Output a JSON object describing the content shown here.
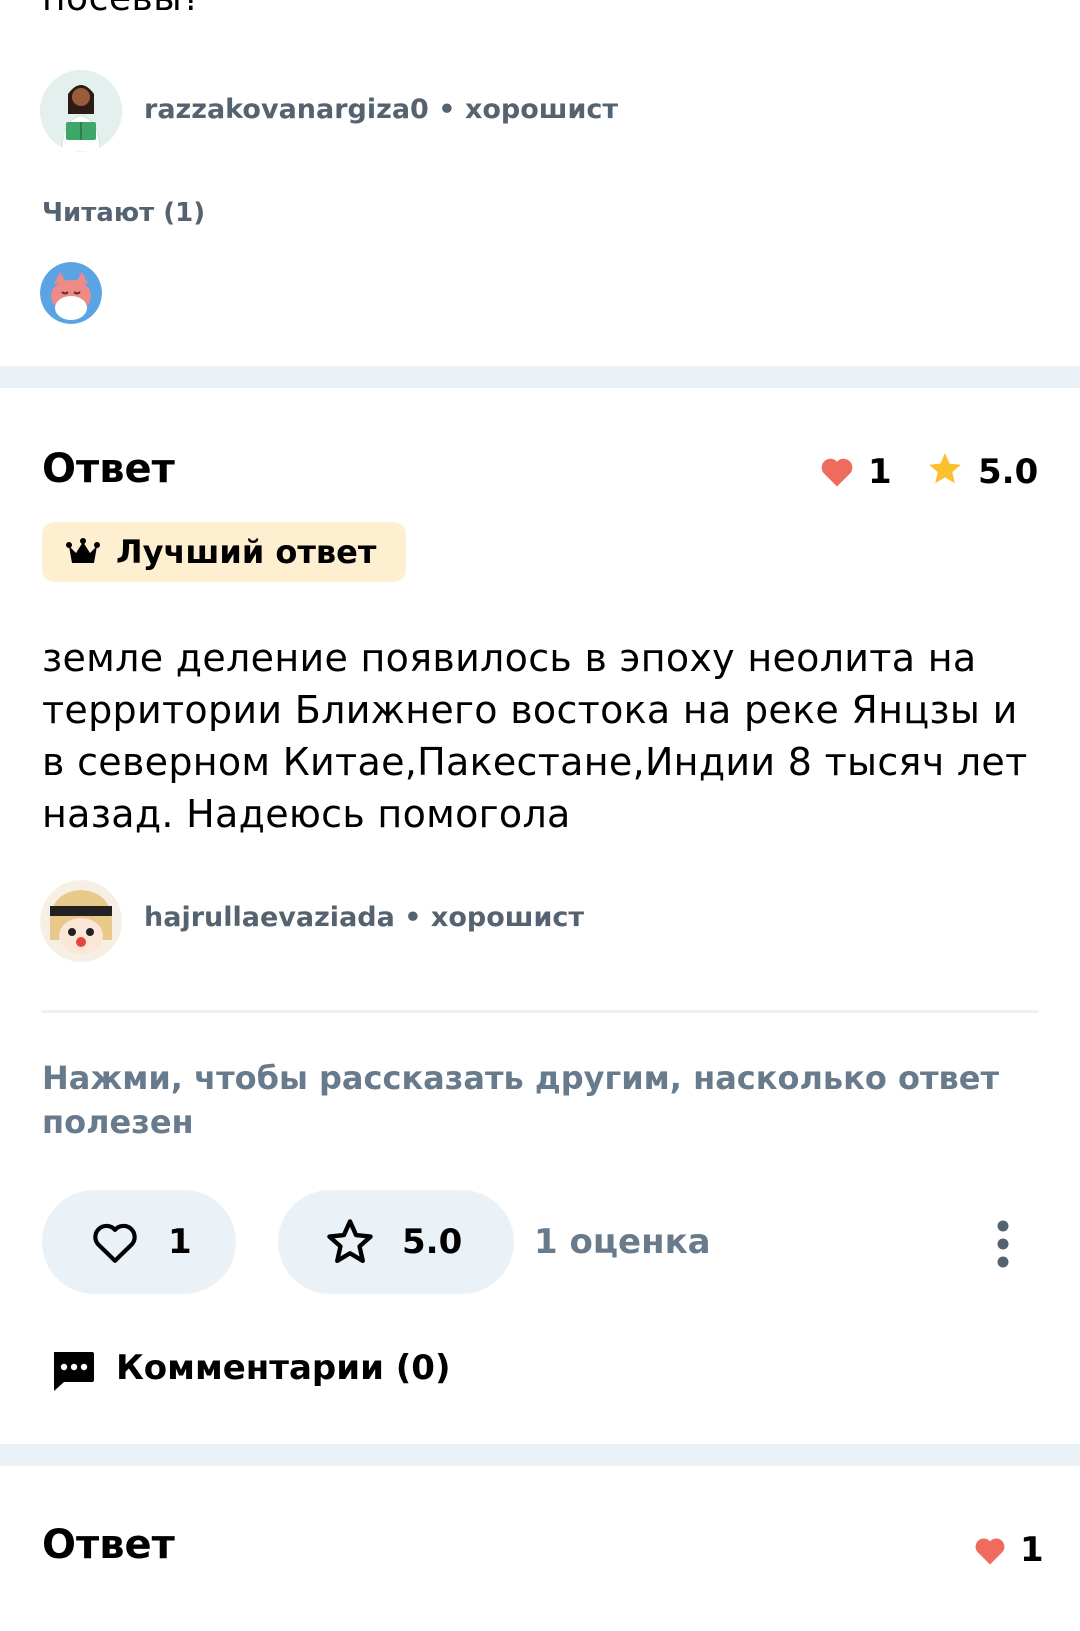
{
  "question": {
    "text_fragment": "посевы?"
  },
  "asker": {
    "username": "razzakovanargiza0",
    "rank": "хорошист",
    "separator": "•"
  },
  "readers": {
    "label": "Читают (1)"
  },
  "best_answer": {
    "title": "Ответ",
    "likes": "1",
    "rating": "5.0",
    "badge_label": "Лучший ответ",
    "text": "земле деление появилось в эпоху неолита на территории Ближнего востока на реке Янцзы и в северном Китае,Пакестане,Индии 8 тысяч лет назад. Надеюсь помогола",
    "author": {
      "username": "hajrullaevaziada",
      "rank": "хорошист",
      "separator": "•"
    },
    "feedback_prompt": "Нажми, чтобы рассказать другим, насколько ответ полезен",
    "like_button_count": "1",
    "rate_button_value": "5.0",
    "ratings_count": "1 оценка",
    "comments_label": "Комментарии (0)"
  },
  "second_answer": {
    "title": "Ответ",
    "likes": "1"
  },
  "colors": {
    "heart": "#ef6b5e",
    "star": "#fbc02d",
    "badge_bg": "#fdefcf",
    "band": "#ebf2f7",
    "muted_text": "#687b8c"
  },
  "icons": {
    "heart": "heart-icon",
    "star": "star-icon",
    "crown": "crown-icon",
    "more": "more-vertical-icon",
    "comment": "comment-icon"
  }
}
